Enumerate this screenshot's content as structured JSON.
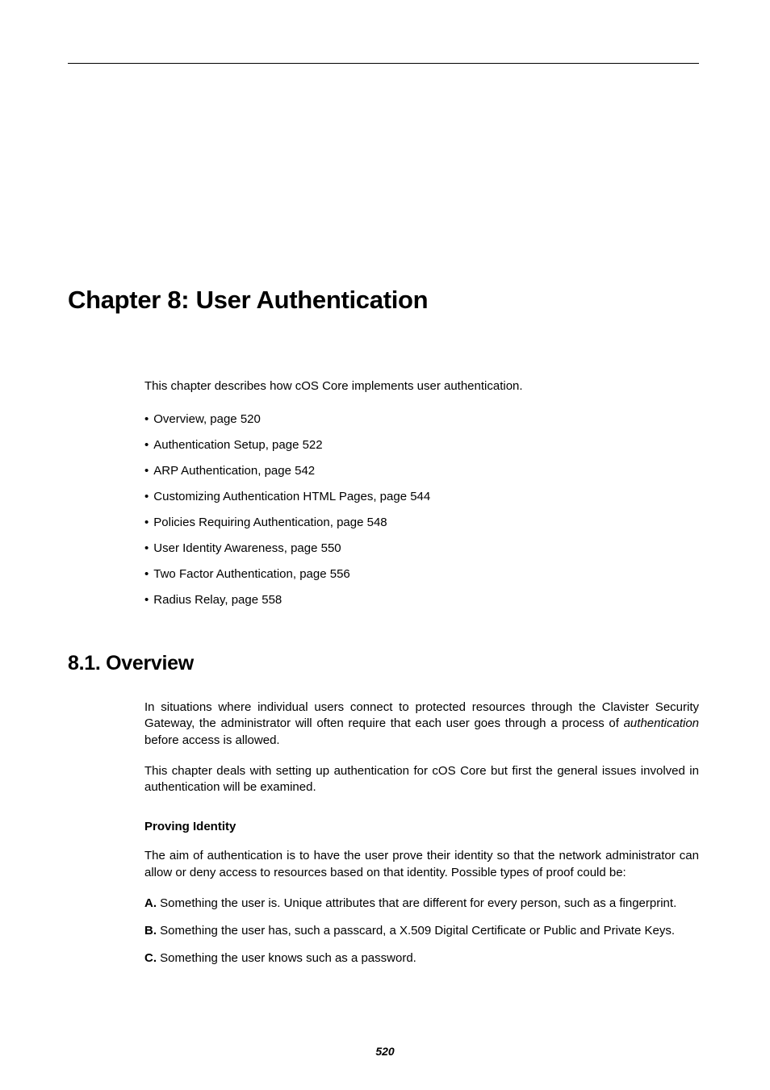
{
  "chapter_title": "Chapter 8: User Authentication",
  "intro": "This chapter describes how cOS Core implements user authentication.",
  "toc": [
    "Overview, page 520",
    "Authentication Setup, page 522",
    "ARP Authentication, page 542",
    "Customizing Authentication HTML Pages, page 544",
    "Policies Requiring Authentication, page 548",
    "User Identity Awareness, page 550",
    "Two Factor Authentication, page 556",
    "Radius Relay, page 558"
  ],
  "section_title": "8.1. Overview",
  "overview_para1_a": "In situations where individual users connect to protected resources through the Clavister Security Gateway, the administrator will often require that each user goes through a process of ",
  "overview_para1_italic": "authentication",
  "overview_para1_b": " before access is allowed.",
  "overview_para2": "This chapter deals with setting up authentication for cOS Core but first the general issues involved in authentication will be examined.",
  "sub_heading": "Proving Identity",
  "proving_para": "The aim of authentication is to have the user prove their identity so that the network administrator can allow or deny access to resources based on that identity. Possible types of proof could be:",
  "proof_a_label": "A.",
  "proof_a_text": " Something the user is. Unique attributes that are different for every person, such as a fingerprint.",
  "proof_b_label": "B.",
  "proof_b_text": " Something the user has, such a passcard, a X.509 Digital Certificate or Public and Private Keys.",
  "proof_c_label": "C.",
  "proof_c_text": " Something the user knows such as a password.",
  "page_number": "520"
}
